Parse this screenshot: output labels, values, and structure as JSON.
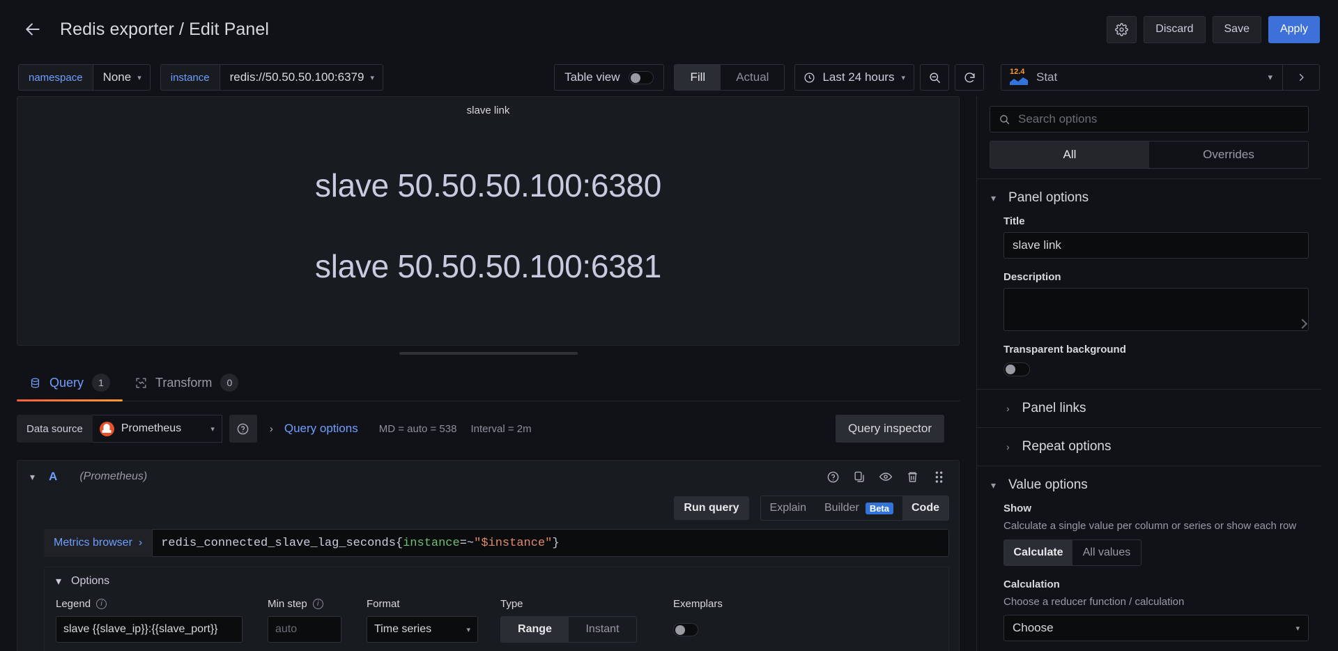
{
  "header": {
    "back_icon": "arrow-left-icon",
    "title": "Redis exporter / Edit Panel",
    "settings_icon": "gear-icon",
    "discard_label": "Discard",
    "save_label": "Save",
    "apply_label": "Apply",
    "accent_color": "#3d71d9"
  },
  "toolbar": {
    "variables": [
      {
        "name": "namespace",
        "value": "None"
      },
      {
        "name": "instance",
        "value": "redis://50.50.50.100:6379"
      }
    ],
    "table_view_label": "Table view",
    "table_view_on": false,
    "fill_actual": {
      "options": [
        "Fill",
        "Actual"
      ],
      "selected": "Fill"
    },
    "time_range": "Last 24 hours",
    "time_icon": "clock-icon",
    "zoom_out_icon": "zoom-out-icon",
    "refresh_icon": "refresh-icon",
    "viz_picker": {
      "icon_number": "12.4",
      "name": "Stat",
      "chevron_icon": "chevron-down-icon",
      "next_icon": "chevron-right-icon"
    }
  },
  "panel": {
    "title": "slave link",
    "values": [
      "slave 50.50.50.100:6380",
      "slave 50.50.50.100:6381"
    ],
    "value_color": "#c8cbe0"
  },
  "tabs": [
    {
      "label": "Query",
      "badge": "1",
      "icon": "database-icon",
      "active": true
    },
    {
      "label": "Transform",
      "badge": "0",
      "icon": "transform-icon",
      "active": false
    }
  ],
  "query": {
    "datasource_label": "Data source",
    "datasource_name": "Prometheus",
    "datasource_icon": "prometheus-icon",
    "help_icon": "help-circle-icon",
    "query_options_label": "Query options",
    "query_options_meta_1": "MD = auto = 538",
    "query_options_meta_2": "Interval = 2m",
    "query_inspector_label": "Query inspector",
    "ref_id": "A",
    "ref_datasource": "(Prometheus)",
    "row_icons": [
      "help-circle-icon",
      "copy-icon",
      "eye-icon",
      "trash-icon",
      "drag-handle-icon"
    ],
    "run_query_label": "Run query",
    "explain_label": "Explain",
    "builder_label": "Builder",
    "builder_badge": "Beta",
    "code_label": "Code",
    "editor_mode_selected": "Code",
    "metrics_browser_label": "Metrics browser",
    "expression": {
      "metric": "redis_connected_slave_lag_seconds",
      "open_brace": "{",
      "label_key": "instance",
      "operator": "=~",
      "label_value": "\"$instance\"",
      "close_brace": "}",
      "full": "redis_connected_slave_lag_seconds{instance=~\"$instance\"}"
    },
    "options": {
      "title": "Options",
      "legend_label": "Legend",
      "legend_value": "slave {{slave_ip}}:{{slave_port}}",
      "min_step_label": "Min step",
      "min_step_placeholder": "auto",
      "format_label": "Format",
      "format_value": "Time series",
      "type_label": "Type",
      "type_options": [
        "Range",
        "Instant"
      ],
      "type_selected": "Range",
      "exemplars_label": "Exemplars",
      "exemplars_on": false
    }
  },
  "options_pane": {
    "search_placeholder": "Search options",
    "search_icon": "search-icon",
    "filter_tabs": {
      "options": [
        "All",
        "Overrides"
      ],
      "selected": "All"
    },
    "panel_options": {
      "group_title": "Panel options",
      "title_label": "Title",
      "title_value": "slave link",
      "description_label": "Description",
      "description_value": "",
      "transparent_label": "Transparent background",
      "transparent_on": false,
      "panel_links_label": "Panel links",
      "repeat_options_label": "Repeat options"
    },
    "value_options": {
      "group_title": "Value options",
      "show_label": "Show",
      "show_desc": "Calculate a single value per column or series or show each row",
      "show_options": [
        "Calculate",
        "All values"
      ],
      "show_selected": "Calculate",
      "calculation_label": "Calculation",
      "calculation_desc": "Choose a reducer function / calculation",
      "calculation_value": "Choose"
    }
  }
}
